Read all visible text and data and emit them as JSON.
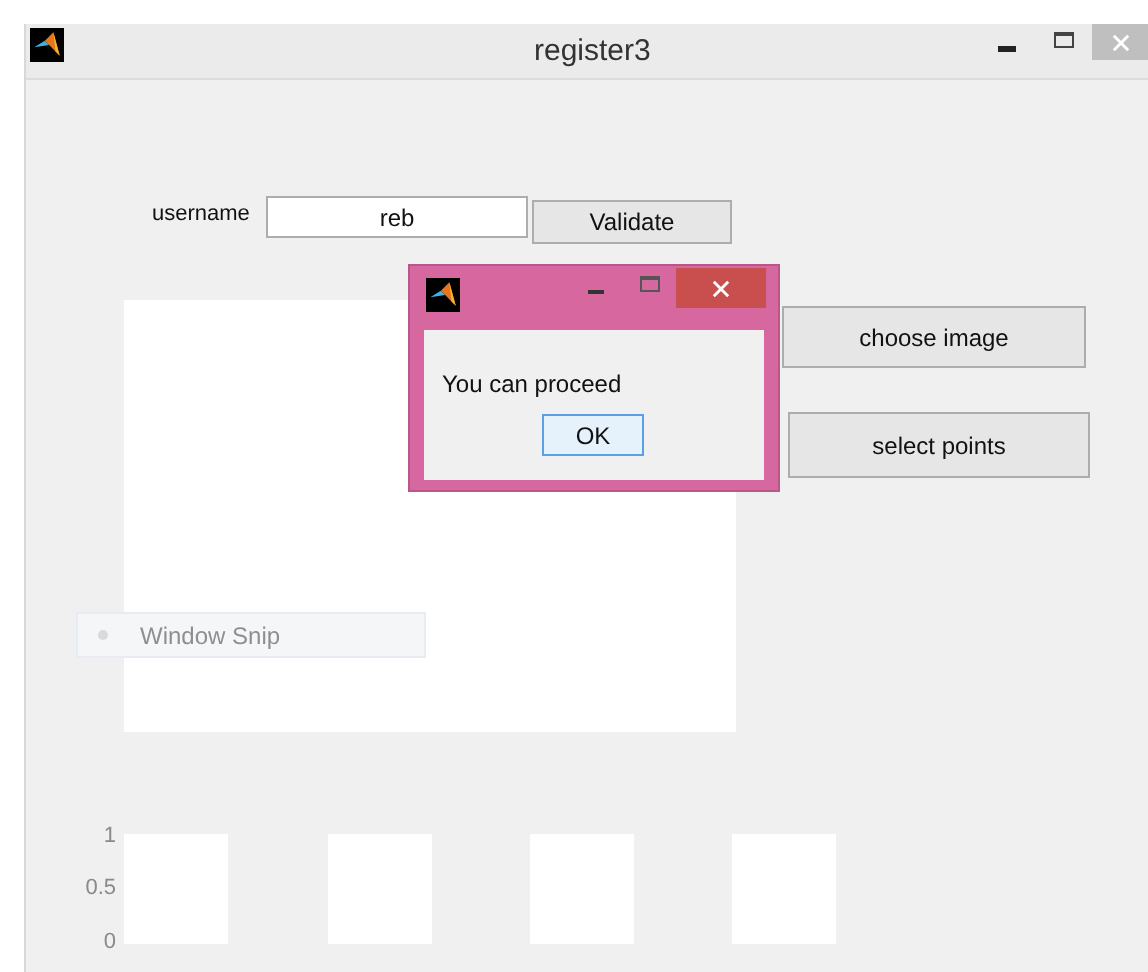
{
  "window": {
    "title": "register3"
  },
  "username": {
    "label": "username",
    "value": "reb"
  },
  "validate_button": "Validate",
  "main_axes": {
    "kind": "axes"
  },
  "side_buttons": [
    "choose image",
    "select points"
  ],
  "small_axes": [
    {
      "kind": "axes",
      "y_ticks": [
        "1",
        "0.5",
        "0"
      ]
    },
    {
      "kind": "axes"
    },
    {
      "kind": "axes"
    },
    {
      "kind": "axes"
    }
  ],
  "snip_label": "Window Snip",
  "dialog": {
    "message": "You can proceed",
    "button": "OK"
  }
}
